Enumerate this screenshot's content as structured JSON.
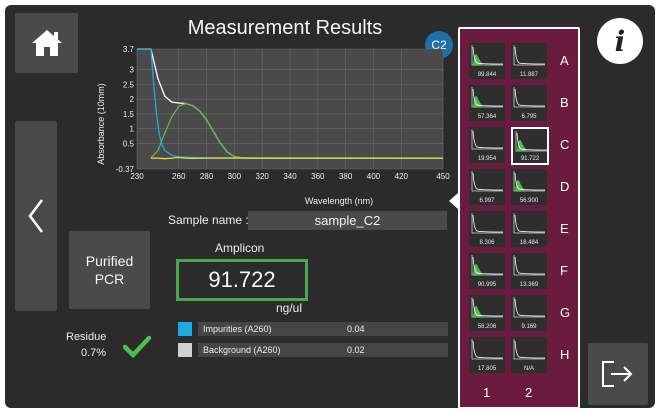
{
  "header": {
    "title": "Measurement Results",
    "well_badge": "C2"
  },
  "nav": {
    "info_label": "i"
  },
  "chart_data": {
    "type": "line",
    "ylabel": "Absorbance (10mm)",
    "xlabel": "Wavelength (nm)",
    "xlim": [
      230,
      450
    ],
    "ylim": [
      -0.37,
      3.7
    ],
    "xticks": [
      "230",
      "260",
      "280",
      "300",
      "320",
      "340",
      "360",
      "380",
      "400",
      "420",
      "450"
    ],
    "yticks": [
      "3.7",
      "3",
      "2.5",
      "2",
      "1.5",
      "1",
      "0.5",
      "-0.37"
    ],
    "grid": true,
    "series": [
      {
        "color": "#ffffff",
        "x": [
          230,
          240,
          245,
          250,
          255,
          260,
          265,
          270,
          275,
          280,
          285,
          290,
          295,
          300,
          305,
          310,
          320,
          450
        ],
        "y": [
          3.7,
          3.7,
          2.7,
          2.1,
          1.9,
          1.87,
          1.85,
          1.78,
          1.6,
          1.3,
          0.9,
          0.5,
          0.2,
          0.05,
          0.01,
          0.0,
          0.0,
          0.0
        ]
      },
      {
        "color": "#1fa9e0",
        "x": [
          230,
          240,
          242,
          244,
          246,
          248,
          250,
          255,
          260,
          270,
          280,
          450
        ],
        "y": [
          3.7,
          3.7,
          2.5,
          1.5,
          0.8,
          0.45,
          0.25,
          0.1,
          0.04,
          0.02,
          0.01,
          0.0
        ]
      },
      {
        "color": "#5fb54a",
        "x": [
          240,
          245,
          250,
          255,
          260,
          265,
          270,
          275,
          280,
          285,
          290,
          295,
          300,
          305,
          310,
          320,
          450
        ],
        "y": [
          0.0,
          0.25,
          0.85,
          1.4,
          1.75,
          1.85,
          1.78,
          1.6,
          1.3,
          0.9,
          0.5,
          0.2,
          0.05,
          0.01,
          0.0,
          0.0,
          0.0
        ]
      },
      {
        "color": "#e8e03a",
        "x": [
          240,
          245,
          250,
          255,
          260,
          265,
          270,
          280,
          300,
          450
        ],
        "y": [
          0.0,
          0.0,
          -0.02,
          0.0,
          0.02,
          0.0,
          -0.01,
          0.0,
          0.0,
          0.0
        ]
      }
    ]
  },
  "sample": {
    "name_label": "Sample name :",
    "name_value": "sample_C2"
  },
  "result": {
    "type_label": "Amplicon",
    "value": "91.722",
    "unit": "ng/ul"
  },
  "purified": {
    "line1": "Purified",
    "line2": "PCR"
  },
  "residue": {
    "label": "Residue",
    "value": "0.7%"
  },
  "impurities": [
    {
      "label": "Impurities (A260)",
      "value": "0.04",
      "color": "#1fa9e0"
    },
    {
      "label": "Background (A260)",
      "value": "0.02",
      "color": "#cfcfcf"
    }
  ],
  "plate": {
    "rows": [
      "A",
      "B",
      "C",
      "D",
      "E",
      "F",
      "G",
      "H"
    ],
    "cols": [
      "1",
      "2"
    ],
    "selected": "C2",
    "wells": [
      [
        "89.844",
        "11.887"
      ],
      [
        "57.364",
        "6.795"
      ],
      [
        "19.954",
        "91.722"
      ],
      [
        "6.997",
        "56.900"
      ],
      [
        "8.306",
        "18.484"
      ],
      [
        "90.995",
        "13.369"
      ],
      [
        "58.206",
        "9.169"
      ],
      [
        "17.805",
        "N/A"
      ]
    ]
  }
}
